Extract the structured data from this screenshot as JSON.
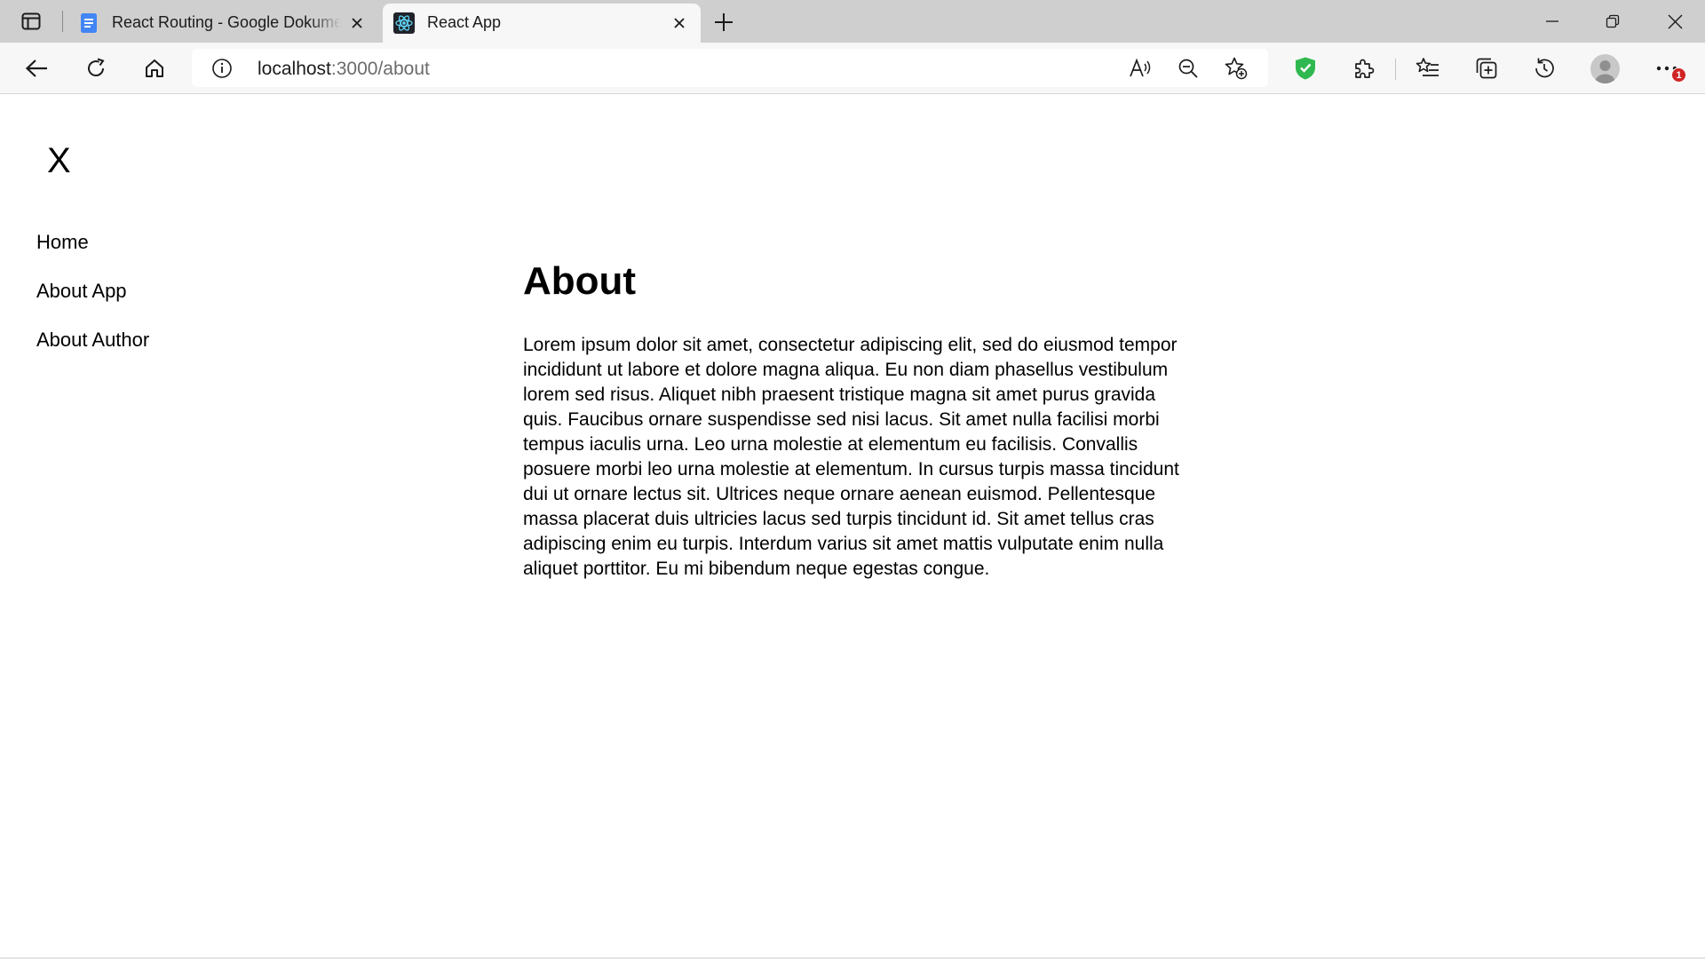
{
  "browser": {
    "tabs": [
      {
        "title": "React Routing - Google Dokumen",
        "favicon": "google-docs-icon",
        "active": false
      },
      {
        "title": "React App",
        "favicon": "react-icon",
        "active": true
      }
    ],
    "address": {
      "host": "localhost",
      "path": ":3000/about"
    },
    "notification_badge": "1",
    "colors": {
      "shield": "#2fb84f",
      "badge": "#d02424",
      "docs": "#4285f4",
      "react": "#61dafb"
    }
  },
  "page": {
    "menu_close": "X",
    "nav": [
      {
        "label": "Home"
      },
      {
        "label": "About App"
      },
      {
        "label": "About Author"
      }
    ],
    "heading": "About",
    "body": "Lorem ipsum dolor sit amet, consectetur adipiscing elit, sed do eiusmod tempor incididunt ut labore et dolore magna aliqua. Eu non diam phasellus vestibulum lorem sed risus. Aliquet nibh praesent tristique magna sit amet purus gravida quis. Faucibus ornare suspendisse sed nisi lacus. Sit amet nulla facilisi morbi tempus iaculis urna. Leo urna molestie at elementum eu facilisis. Convallis posuere morbi leo urna molestie at elementum. In cursus turpis massa tincidunt dui ut ornare lectus sit. Ultrices neque ornare aenean euismod. Pellentesque massa placerat duis ultricies lacus sed turpis tincidunt id. Sit amet tellus cras adipiscing enim eu turpis. Interdum varius sit amet mattis vulputate enim nulla aliquet porttitor. Eu mi bibendum neque egestas congue."
  }
}
